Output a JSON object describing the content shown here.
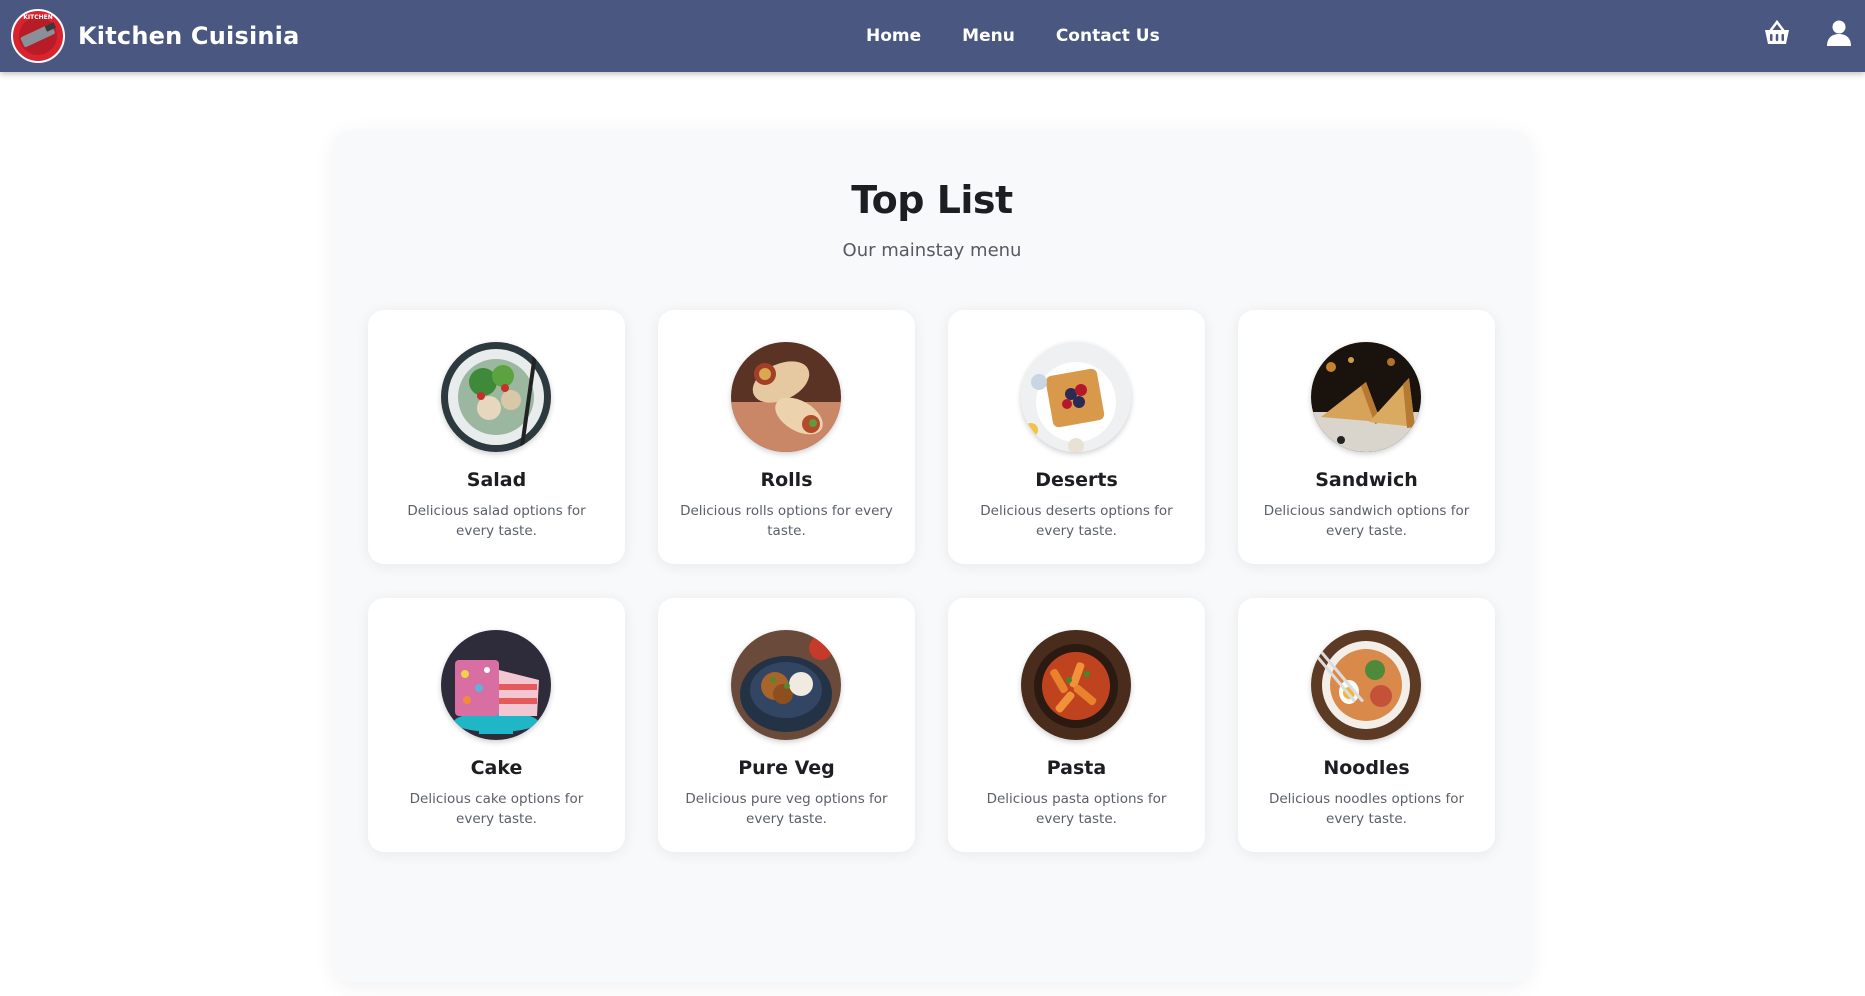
{
  "brand": {
    "name": "Kitchen Cuisinia",
    "logo_icon": "kitchen-logo-icon",
    "logo_text": "KITCHEN"
  },
  "nav": {
    "links": [
      {
        "label": "Home"
      },
      {
        "label": "Menu"
      },
      {
        "label": "Contact Us"
      }
    ],
    "cart_icon": "basket-icon",
    "user_icon": "user-icon"
  },
  "colors": {
    "navbar": "#4a5780",
    "panel": "#f8f9fa",
    "card": "#ffffff"
  },
  "top_list": {
    "title": "Top List",
    "subtitle": "Our mainstay menu",
    "items": [
      {
        "name": "Salad",
        "description": "Delicious salad options for every taste."
      },
      {
        "name": "Rolls",
        "description": "Delicious rolls options for every taste."
      },
      {
        "name": "Deserts",
        "description": "Delicious deserts options for every taste."
      },
      {
        "name": "Sandwich",
        "description": "Delicious sandwich options for every taste."
      },
      {
        "name": "Cake",
        "description": "Delicious cake options for every taste."
      },
      {
        "name": "Pure Veg",
        "description": "Delicious pure veg options for every taste."
      },
      {
        "name": "Pasta",
        "description": "Delicious pasta options for every taste."
      },
      {
        "name": "Noodles",
        "description": "Delicious noodles options for every taste."
      }
    ]
  }
}
